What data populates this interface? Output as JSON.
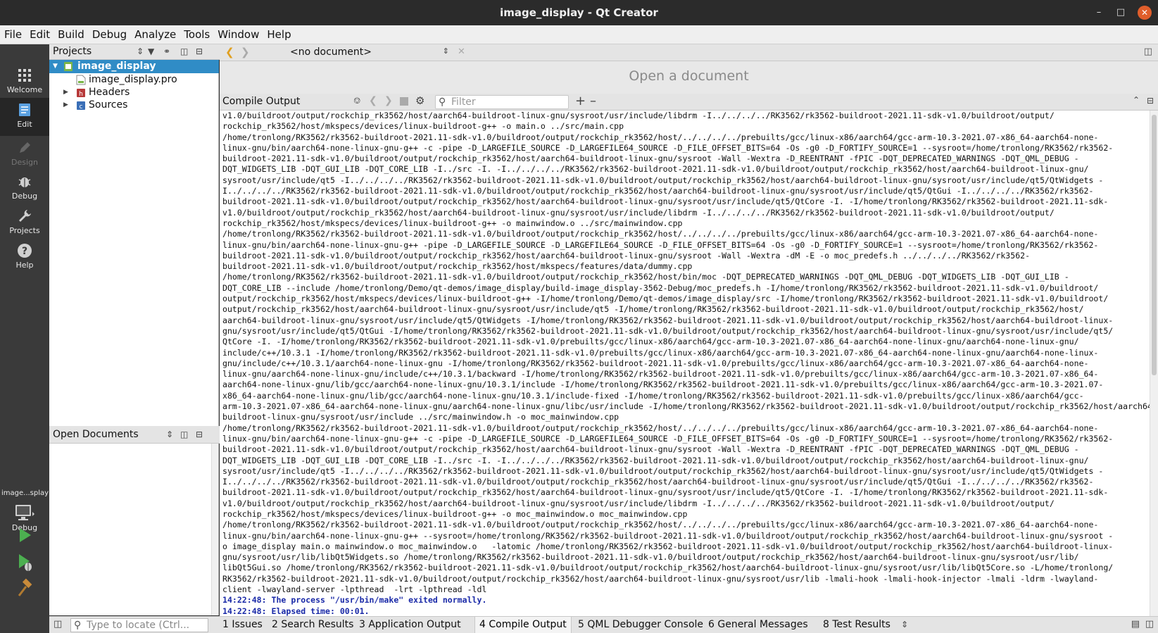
{
  "window": {
    "title": "image_display - Qt Creator"
  },
  "menu": [
    "File",
    "Edit",
    "Build",
    "Debug",
    "Analyze",
    "Tools",
    "Window",
    "Help"
  ],
  "modes": [
    {
      "label": "Welcome",
      "icon": "grid-icon"
    },
    {
      "label": "Edit",
      "icon": "document-icon"
    },
    {
      "label": "Design",
      "icon": "pencil-icon"
    },
    {
      "label": "Debug",
      "icon": "bug-icon"
    },
    {
      "label": "Projects",
      "icon": "wrench-icon"
    },
    {
      "label": "Help",
      "icon": "help-icon"
    }
  ],
  "kit": {
    "name": "image...splay",
    "mode": "Debug"
  },
  "projects": {
    "title": "Projects",
    "tree": [
      {
        "label": "image_display",
        "level": 0,
        "expanded": true,
        "selected": true
      },
      {
        "label": "image_display.pro",
        "level": 1
      },
      {
        "label": "Headers",
        "level": 1,
        "expanded": false
      },
      {
        "label": "Sources",
        "level": 1,
        "expanded": false
      }
    ]
  },
  "open_documents": {
    "title": "Open Documents"
  },
  "editor": {
    "document_combo": "<no document>",
    "placeholder": "Open a document"
  },
  "compile_output": {
    "title": "Compile Output",
    "filter_placeholder": "Filter",
    "lines": [
      "v1.0/buildroot/output/rockchip_rk3562/host/aarch64-buildroot-linux-gnu/sysroot/usr/include/libdrm -I../../../../RK3562/rk3562-buildroot-2021.11-sdk-v1.0/buildroot/output/",
      "rockchip_rk3562/host/mkspecs/devices/linux-buildroot-g++ -o main.o ../src/main.cpp",
      "/home/tronlong/RK3562/rk3562-buildroot-2021.11-sdk-v1.0/buildroot/output/rockchip_rk3562/host/../../../../prebuilts/gcc/linux-x86/aarch64/gcc-arm-10.3-2021.07-x86_64-aarch64-none-",
      "linux-gnu/bin/aarch64-none-linux-gnu-g++ -c -pipe -D_LARGEFILE_SOURCE -D_LARGEFILE64_SOURCE -D_FILE_OFFSET_BITS=64 -Os -g0 -D_FORTIFY_SOURCE=1 --sysroot=/home/tronlong/RK3562/rk3562-",
      "buildroot-2021.11-sdk-v1.0/buildroot/output/rockchip_rk3562/host/aarch64-buildroot-linux-gnu/sysroot -Wall -Wextra -D_REENTRANT -fPIC -DQT_DEPRECATED_WARNINGS -DQT_QML_DEBUG -",
      "DQT_WIDGETS_LIB -DQT_GUI_LIB -DQT_CORE_LIB -I../src -I. -I../../../../RK3562/rk3562-buildroot-2021.11-sdk-v1.0/buildroot/output/rockchip_rk3562/host/aarch64-buildroot-linux-gnu/",
      "sysroot/usr/include/qt5 -I../../../../RK3562/rk3562-buildroot-2021.11-sdk-v1.0/buildroot/output/rockchip_rk3562/host/aarch64-buildroot-linux-gnu/sysroot/usr/include/qt5/QtWidgets -",
      "I../../../../RK3562/rk3562-buildroot-2021.11-sdk-v1.0/buildroot/output/rockchip_rk3562/host/aarch64-buildroot-linux-gnu/sysroot/usr/include/qt5/QtGui -I../../../../RK3562/rk3562-",
      "buildroot-2021.11-sdk-v1.0/buildroot/output/rockchip_rk3562/host/aarch64-buildroot-linux-gnu/sysroot/usr/include/qt5/QtCore -I. -I/home/tronlong/RK3562/rk3562-buildroot-2021.11-sdk-",
      "v1.0/buildroot/output/rockchip_rk3562/host/aarch64-buildroot-linux-gnu/sysroot/usr/include/libdrm -I../../../../RK3562/rk3562-buildroot-2021.11-sdk-v1.0/buildroot/output/",
      "rockchip_rk3562/host/mkspecs/devices/linux-buildroot-g++ -o mainwindow.o ../src/mainwindow.cpp",
      "/home/tronlong/RK3562/rk3562-buildroot-2021.11-sdk-v1.0/buildroot/output/rockchip_rk3562/host/../../../../prebuilts/gcc/linux-x86/aarch64/gcc-arm-10.3-2021.07-x86_64-aarch64-none-",
      "linux-gnu/bin/aarch64-none-linux-gnu-g++ -pipe -D_LARGEFILE_SOURCE -D_LARGEFILE64_SOURCE -D_FILE_OFFSET_BITS=64 -Os -g0 -D_FORTIFY_SOURCE=1 --sysroot=/home/tronlong/RK3562/rk3562-",
      "buildroot-2021.11-sdk-v1.0/buildroot/output/rockchip_rk3562/host/aarch64-buildroot-linux-gnu/sysroot -Wall -Wextra -dM -E -o moc_predefs.h ../../../../RK3562/rk3562-",
      "buildroot-2021.11-sdk-v1.0/buildroot/output/rockchip_rk3562/host/mkspecs/features/data/dummy.cpp",
      "/home/tronlong/RK3562/rk3562-buildroot-2021.11-sdk-v1.0/buildroot/output/rockchip_rk3562/host/bin/moc -DQT_DEPRECATED_WARNINGS -DQT_QML_DEBUG -DQT_WIDGETS_LIB -DQT_GUI_LIB -",
      "DQT_CORE_LIB --include /home/tronlong/Demo/qt-demos/image_display/build-image_display-3562-Debug/moc_predefs.h -I/home/tronlong/RK3562/rk3562-buildroot-2021.11-sdk-v1.0/buildroot/",
      "output/rockchip_rk3562/host/mkspecs/devices/linux-buildroot-g++ -I/home/tronlong/Demo/qt-demos/image_display/src -I/home/tronlong/RK3562/rk3562-buildroot-2021.11-sdk-v1.0/buildroot/",
      "output/rockchip_rk3562/host/aarch64-buildroot-linux-gnu/sysroot/usr/include/qt5 -I/home/tronlong/RK3562/rk3562-buildroot-2021.11-sdk-v1.0/buildroot/output/rockchip_rk3562/host/",
      "aarch64-buildroot-linux-gnu/sysroot/usr/include/qt5/QtWidgets -I/home/tronlong/RK3562/rk3562-buildroot-2021.11-sdk-v1.0/buildroot/output/rockchip_rk3562/host/aarch64-buildroot-linux-",
      "gnu/sysroot/usr/include/qt5/QtGui -I/home/tronlong/RK3562/rk3562-buildroot-2021.11-sdk-v1.0/buildroot/output/rockchip_rk3562/host/aarch64-buildroot-linux-gnu/sysroot/usr/include/qt5/",
      "QtCore -I. -I/home/tronlong/RK3562/rk3562-buildroot-2021.11-sdk-v1.0/prebuilts/gcc/linux-x86/aarch64/gcc-arm-10.3-2021.07-x86_64-aarch64-none-linux-gnu/aarch64-none-linux-gnu/",
      "include/c++/10.3.1 -I/home/tronlong/RK3562/rk3562-buildroot-2021.11-sdk-v1.0/prebuilts/gcc/linux-x86/aarch64/gcc-arm-10.3-2021.07-x86_64-aarch64-none-linux-gnu/aarch64-none-linux-",
      "gnu/include/c++/10.3.1/aarch64-none-linux-gnu -I/home/tronlong/RK3562/rk3562-buildroot-2021.11-sdk-v1.0/prebuilts/gcc/linux-x86/aarch64/gcc-arm-10.3-2021.07-x86_64-aarch64-none-",
      "linux-gnu/aarch64-none-linux-gnu/include/c++/10.3.1/backward -I/home/tronlong/RK3562/rk3562-buildroot-2021.11-sdk-v1.0/prebuilts/gcc/linux-x86/aarch64/gcc-arm-10.3-2021.07-x86_64-",
      "aarch64-none-linux-gnu/lib/gcc/aarch64-none-linux-gnu/10.3.1/include -I/home/tronlong/RK3562/rk3562-buildroot-2021.11-sdk-v1.0/prebuilts/gcc/linux-x86/aarch64/gcc-arm-10.3-2021.07-",
      "x86_64-aarch64-none-linux-gnu/lib/gcc/aarch64-none-linux-gnu/10.3.1/include-fixed -I/home/tronlong/RK3562/rk3562-buildroot-2021.11-sdk-v1.0/prebuilts/gcc/linux-x86/aarch64/gcc-",
      "arm-10.3-2021.07-x86_64-aarch64-none-linux-gnu/aarch64-none-linux-gnu/libc/usr/include -I/home/tronlong/RK3562/rk3562-buildroot-2021.11-sdk-v1.0/buildroot/output/rockchip_rk3562/host/aarch64-",
      "buildroot-linux-gnu/sysroot/usr/include ../src/mainwindow.h -o moc_mainwindow.cpp",
      "/home/tronlong/RK3562/rk3562-buildroot-2021.11-sdk-v1.0/buildroot/output/rockchip_rk3562/host/../../../../prebuilts/gcc/linux-x86/aarch64/gcc-arm-10.3-2021.07-x86_64-aarch64-none-",
      "linux-gnu/bin/aarch64-none-linux-gnu-g++ -c -pipe -D_LARGEFILE_SOURCE -D_LARGEFILE64_SOURCE -D_FILE_OFFSET_BITS=64 -Os -g0 -D_FORTIFY_SOURCE=1 --sysroot=/home/tronlong/RK3562/rk3562-",
      "buildroot-2021.11-sdk-v1.0/buildroot/output/rockchip_rk3562/host/aarch64-buildroot-linux-gnu/sysroot -Wall -Wextra -D_REENTRANT -fPIC -DQT_DEPRECATED_WARNINGS -DQT_QML_DEBUG -",
      "DQT_WIDGETS_LIB -DQT_GUI_LIB -DQT_CORE_LIB -I../src -I. -I../../../../RK3562/rk3562-buildroot-2021.11-sdk-v1.0/buildroot/output/rockchip_rk3562/host/aarch64-buildroot-linux-gnu/",
      "sysroot/usr/include/qt5 -I../../../../RK3562/rk3562-buildroot-2021.11-sdk-v1.0/buildroot/output/rockchip_rk3562/host/aarch64-buildroot-linux-gnu/sysroot/usr/include/qt5/QtWidgets -",
      "I../../../../RK3562/rk3562-buildroot-2021.11-sdk-v1.0/buildroot/output/rockchip_rk3562/host/aarch64-buildroot-linux-gnu/sysroot/usr/include/qt5/QtGui -I../../../../RK3562/rk3562-",
      "buildroot-2021.11-sdk-v1.0/buildroot/output/rockchip_rk3562/host/aarch64-buildroot-linux-gnu/sysroot/usr/include/qt5/QtCore -I. -I/home/tronlong/RK3562/rk3562-buildroot-2021.11-sdk-",
      "v1.0/buildroot/output/rockchip_rk3562/host/aarch64-buildroot-linux-gnu/sysroot/usr/include/libdrm -I../../../../RK3562/rk3562-buildroot-2021.11-sdk-v1.0/buildroot/output/",
      "rockchip_rk3562/host/mkspecs/devices/linux-buildroot-g++ -o moc_mainwindow.o moc_mainwindow.cpp",
      "/home/tronlong/RK3562/rk3562-buildroot-2021.11-sdk-v1.0/buildroot/output/rockchip_rk3562/host/../../../../prebuilts/gcc/linux-x86/aarch64/gcc-arm-10.3-2021.07-x86_64-aarch64-none-",
      "linux-gnu/bin/aarch64-none-linux-gnu-g++ --sysroot=/home/tronlong/RK3562/rk3562-buildroot-2021.11-sdk-v1.0/buildroot/output/rockchip_rk3562/host/aarch64-buildroot-linux-gnu/sysroot -",
      "o image_display main.o mainwindow.o moc_mainwindow.o   -latomic /home/tronlong/RK3562/rk3562-buildroot-2021.11-sdk-v1.0/buildroot/output/rockchip_rk3562/host/aarch64-buildroot-linux-",
      "gnu/sysroot/usr/lib/libQt5Widgets.so /home/tronlong/RK3562/rk3562-buildroot-2021.11-sdk-v1.0/buildroot/output/rockchip_rk3562/host/aarch64-buildroot-linux-gnu/sysroot/usr/lib/",
      "libQt5Gui.so /home/tronlong/RK3562/rk3562-buildroot-2021.11-sdk-v1.0/buildroot/output/rockchip_rk3562/host/aarch64-buildroot-linux-gnu/sysroot/usr/lib/libQt5Core.so -L/home/tronlong/",
      "RK3562/rk3562-buildroot-2021.11-sdk-v1.0/buildroot/output/rockchip_rk3562/host/aarch64-buildroot-linux-gnu/sysroot/usr/lib -lmali-hook -lmali-hook-injector -lmali -ldrm -lwayland-",
      "client -lwayland-server -lpthread  -lrt -lpthread -ldl"
    ],
    "status_lines": [
      "14:22:48: The process \"/usr/bin/make\" exited normally.",
      "14:22:48: Elapsed time: 00:01."
    ]
  },
  "locator": {
    "placeholder": "Type to locate (Ctrl..."
  },
  "output_tabs": [
    {
      "label": "1  Issues"
    },
    {
      "label": "2  Search Results"
    },
    {
      "label": "3  Application Output"
    },
    {
      "label": "4  Compile Output",
      "active": true
    },
    {
      "label": "5  QML Debugger Console"
    },
    {
      "label": "6  General Messages"
    },
    {
      "label": "8  Test Results"
    }
  ],
  "colors": {
    "accent": "#308cc6",
    "status_text": "#1a2aa8",
    "run_green": "#4caf50"
  }
}
